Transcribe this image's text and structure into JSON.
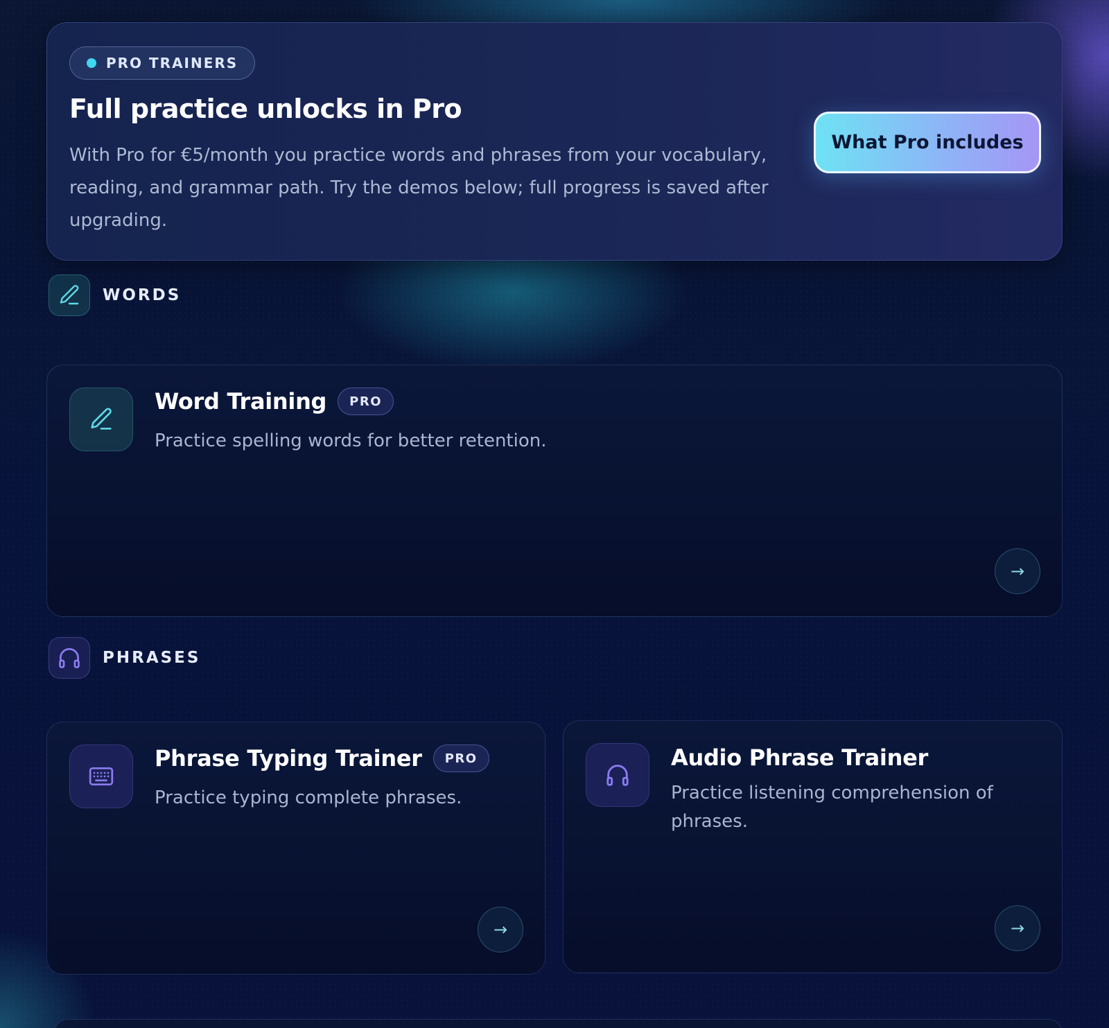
{
  "hero": {
    "badge": "PRO TRAINERS",
    "title": "Full practice unlocks in Pro",
    "description": "With Pro for €5/month you practice words and phrases from your vocabulary, reading, and grammar path. Try the demos below; full progress is saved after upgrading.",
    "cta_label": "What Pro includes"
  },
  "sections": {
    "words": {
      "label": "WORDS",
      "icon": "pencil-icon"
    },
    "phrases": {
      "label": "PHRASES",
      "icon": "headphones-icon"
    }
  },
  "cards": {
    "word_training": {
      "title": "Word Training",
      "badge": "PRO",
      "description": "Practice spelling words for better retention.",
      "icon": "pencil-icon",
      "arrow": "→"
    },
    "phrase_typing": {
      "title": "Phrase Typing Trainer",
      "badge": "PRO",
      "description": "Practice typing complete phrases.",
      "icon": "keyboard-icon",
      "arrow": "→"
    },
    "audio_phrase": {
      "title": "Audio Phrase Trainer",
      "description": "Practice listening comprehension of phrases.",
      "icon": "headphones-icon",
      "arrow": "→"
    }
  },
  "colors": {
    "background": "#07122f",
    "accent_teal": "#3fd6f0",
    "accent_violet": "#8b7cf0"
  }
}
